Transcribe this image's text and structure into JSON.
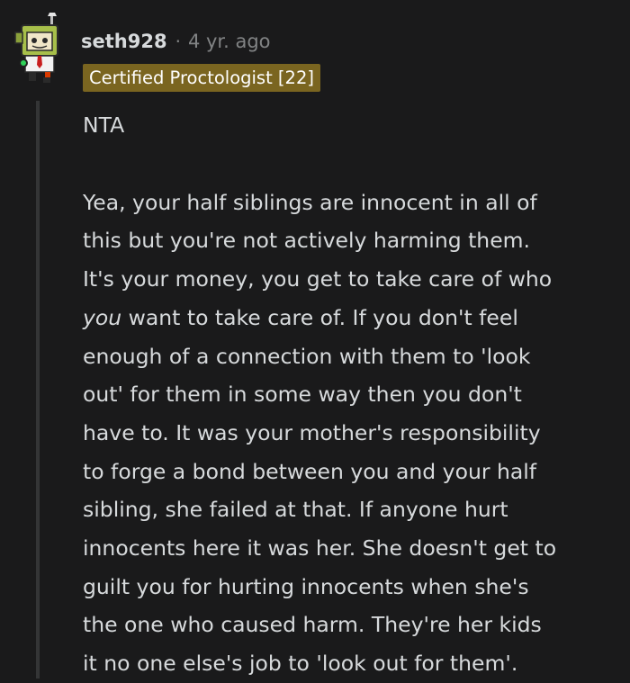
{
  "comment": {
    "username": "seth928",
    "separator": "·",
    "timestamp": "4 yr. ago",
    "flair": "Certified Proctologist [22]",
    "paragraph1": "NTA",
    "paragraph2_lines": [
      "Yea, your half siblings are innocent in all of",
      "this but you're not actively harming them.",
      "It's your money, you get to take care of who",
      {
        "em": "you",
        "rest": " want to take care of. If you don't feel"
      },
      "enough of a connection with them to 'look",
      "out' for them in some way then you don't",
      "have to. It was your mother's responsibility",
      "to forge a bond between you and your half",
      "sibling, she failed at that. If anyone hurt",
      "innocents here it was her. She doesn't get to",
      "guilt you for hurting innocents when she's",
      "the one who caused harm. They're her kids",
      "it no one else's job to 'look out for them'."
    ]
  },
  "colors": {
    "background": "#1a1a1b",
    "text": "#d7dadc",
    "muted": "#818384",
    "flair_bg": "#7a6520",
    "thread_line": "#343536"
  }
}
